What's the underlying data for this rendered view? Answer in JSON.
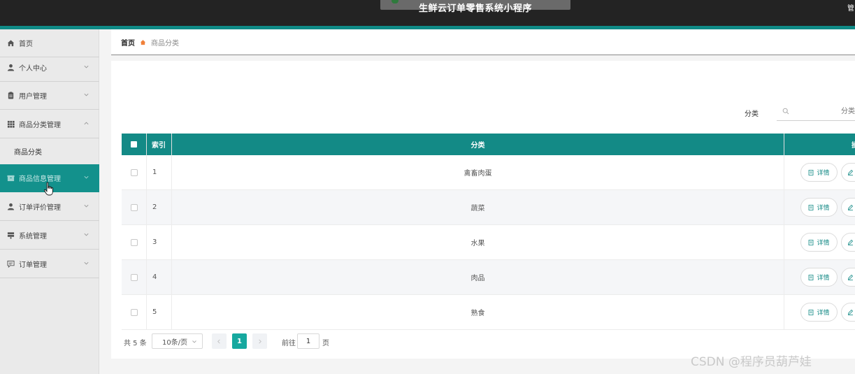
{
  "app": {
    "title": "生鲜云订单零售系统小程序",
    "top_right_text": "管"
  },
  "sidebar": {
    "items": [
      {
        "label": "首页",
        "icon": "home-icon"
      },
      {
        "label": "个人中心",
        "icon": "user-icon"
      },
      {
        "label": "用户管理",
        "icon": "clipboard-icon"
      },
      {
        "label": "商品分类管理",
        "icon": "grid-icon"
      },
      {
        "label": "商品信息管理",
        "icon": "box-icon"
      },
      {
        "label": "订单评价管理",
        "icon": "user-icon"
      },
      {
        "label": "系统管理",
        "icon": "server-icon"
      },
      {
        "label": "订单管理",
        "icon": "message-icon"
      }
    ],
    "submenu": {
      "label": "商品分类"
    }
  },
  "breadcrumb": {
    "home": "首页",
    "current": "商品分类"
  },
  "search": {
    "label": "分类",
    "placeholder": "分类"
  },
  "table": {
    "headers": {
      "index": "索引",
      "category": "分类",
      "action": "操作"
    },
    "rows": [
      {
        "index": "1",
        "category": "禽畜肉蛋"
      },
      {
        "index": "2",
        "category": "蔬菜"
      },
      {
        "index": "3",
        "category": "水果"
      },
      {
        "index": "4",
        "category": "肉品"
      },
      {
        "index": "5",
        "category": "熟食"
      }
    ],
    "detail_label": "详情"
  },
  "pagination": {
    "total": "共 5 条",
    "page_size": "10条/页",
    "current_page": "1",
    "goto_label": "前往",
    "goto_value": "1",
    "goto_suffix": "页"
  },
  "watermark": "CSDN @程序员葫芦娃",
  "colors": {
    "teal": "#138a86",
    "active_menu": "#13918c",
    "page_active": "#16a89f",
    "topbar": "#232323"
  }
}
